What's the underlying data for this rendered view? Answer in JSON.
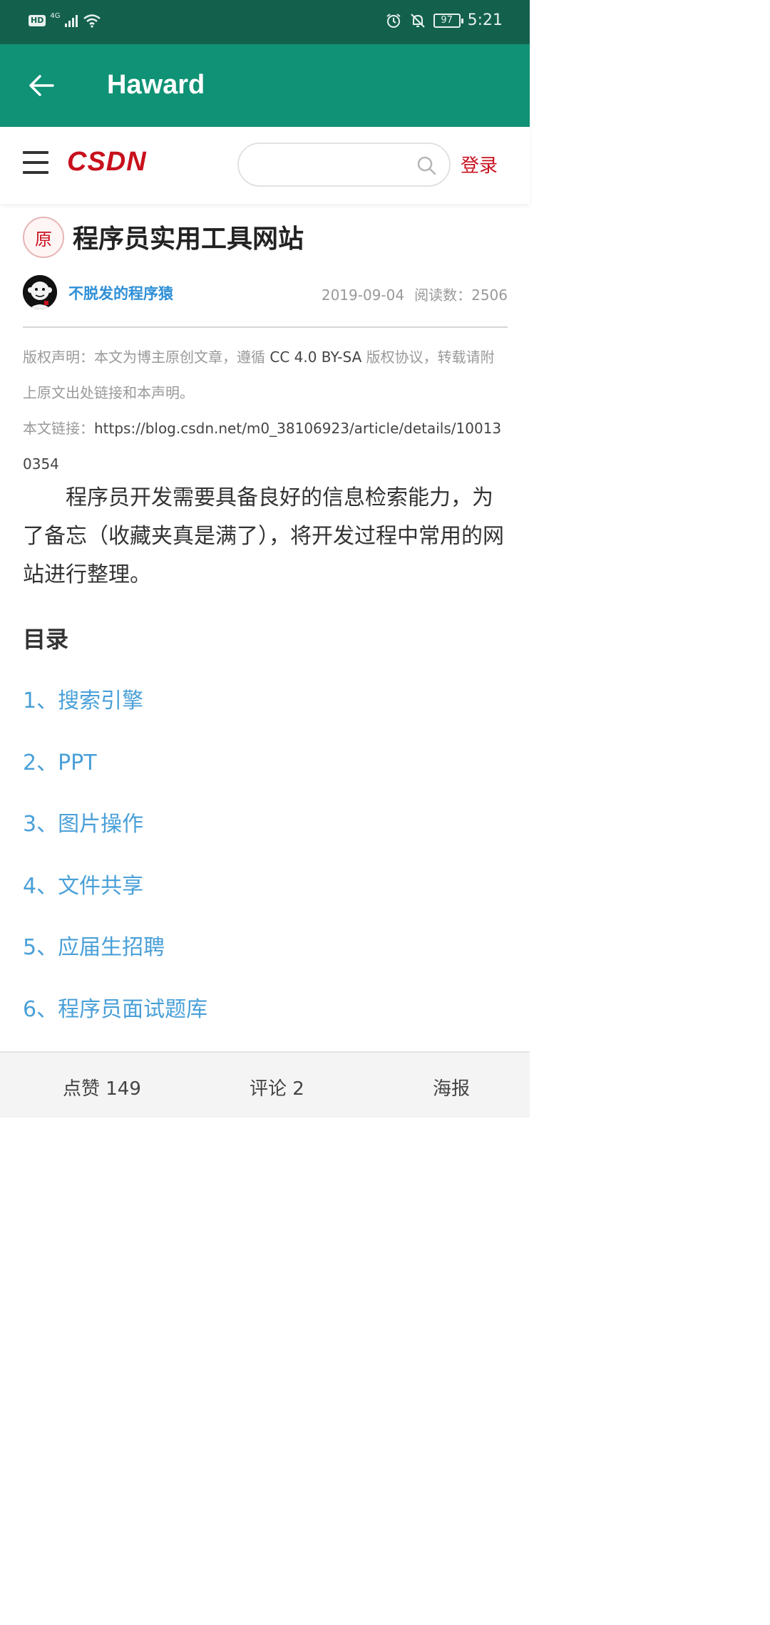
{
  "status_bar": {
    "hd_label": "HD",
    "network_label": "4G",
    "battery_level": "97",
    "time": "5:21"
  },
  "app_bar": {
    "title": "Haward"
  },
  "site_header": {
    "logo_text": "CSDN",
    "search_placeholder": "",
    "login_label": "登录"
  },
  "article": {
    "original_badge": "原",
    "title": "程序员实用工具网站",
    "author": "不脱发的程序猿",
    "date": "2019-09-04",
    "reads_label": "阅读数：",
    "reads": "2506",
    "copyright_prefix": "版权声明：本文为博主原创文章，遵循",
    "copyright_license": "CC 4.0 BY-SA",
    "copyright_suffix": "版权协议，转载请附上原文出处链接和本声明。",
    "link_label": "本文链接：",
    "link_url": "https://blog.csdn.net/m0_38106923/article/details/100130354",
    "intro": "程序员开发需要具备良好的信息检索能力，为了备忘（收藏夹真是满了），将开发过程中常用的网站进行整理。",
    "toc_heading": "目录",
    "toc": [
      "1、搜索引擎",
      "2、PPT",
      "3、图片操作",
      "4、文件共享",
      "5、应届生招聘",
      "6、程序员面试题库"
    ]
  },
  "bottom_bar": {
    "like_label": "点赞 149",
    "comment_label": "评论 2",
    "poster_label": "海报"
  },
  "colors": {
    "status_bar": "#13614d",
    "app_bar": "#0f9275",
    "brand_red": "#c8101d",
    "author_blue": "#2e8fd6",
    "toc_blue": "#4aa0d8"
  }
}
